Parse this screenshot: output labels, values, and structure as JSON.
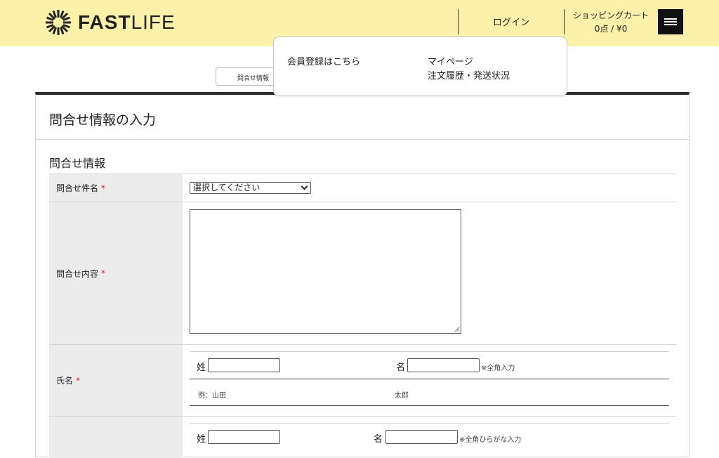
{
  "header": {
    "logo": {
      "bold": "FAST",
      "light": "LIFE"
    },
    "login": "ログイン",
    "cart": {
      "title": "ショッピングカート",
      "summary": "0点 / ¥0"
    },
    "menu_icon": "hamburger-icon"
  },
  "dropdown": {
    "register": "会員登録はこちら",
    "mypage": "マイページ",
    "orders": "注文履歴・発送状況"
  },
  "steps": {
    "current": "問合せ情報"
  },
  "page": {
    "title": "問合せ情報の入力",
    "section": "問合せ情報"
  },
  "form": {
    "required_mark": "*",
    "subject": {
      "label": "問合せ件名",
      "selected": "選択してください"
    },
    "content": {
      "label": "問合せ内容"
    },
    "name": {
      "label": "氏名",
      "last_label": "姓",
      "first_label": "名",
      "note": "※全角入力",
      "example_last": "例：山田",
      "example_first": "太郎"
    },
    "kana": {
      "last_label": "姓",
      "first_label": "名",
      "note": "※全角ひらがな入力"
    }
  },
  "colors": {
    "header_bg": "#fbf1a9",
    "required": "#d62020",
    "panel_top": "#2b2b2b"
  }
}
